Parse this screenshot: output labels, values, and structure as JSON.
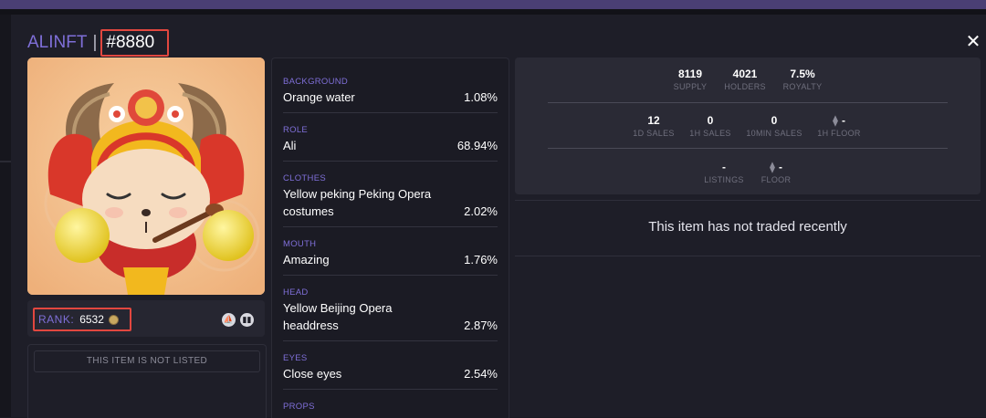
{
  "header": {
    "collection": "ALINFT",
    "separator": "|",
    "token_id": "#8880",
    "close_icon": "close-icon"
  },
  "rank": {
    "label": "RANK:",
    "value": "6532",
    "coin_icon": "coin-icon",
    "icons": [
      "opensea-icon",
      "chart-icon"
    ]
  },
  "listing": {
    "status": "THIS ITEM IS NOT LISTED"
  },
  "traits": [
    {
      "type": "BACKGROUND",
      "value": "Orange water",
      "percent": "1.08%"
    },
    {
      "type": "ROLE",
      "value": "Ali",
      "percent": "68.94%"
    },
    {
      "type": "CLOTHES",
      "value": "Yellow peking Peking Opera costumes",
      "percent": "2.02%"
    },
    {
      "type": "MOUTH",
      "value": "Amazing",
      "percent": "1.76%"
    },
    {
      "type": "HEAD",
      "value": "Yellow Beijing Opera headdress",
      "percent": "2.87%"
    },
    {
      "type": "EYES",
      "value": "Close eyes",
      "percent": "2.54%"
    },
    {
      "type": "PROPS",
      "value": "",
      "percent": ""
    }
  ],
  "stats": {
    "supply": {
      "value": "8119",
      "label": "SUPPLY"
    },
    "holders": {
      "value": "4021",
      "label": "HOLDERS"
    },
    "royalty": {
      "value": "7.5%",
      "label": "ROYALTY"
    },
    "sales_1d": {
      "value": "12",
      "label": "1D SALES"
    },
    "sales_1h": {
      "value": "0",
      "label": "1H SALES"
    },
    "sales_10min": {
      "value": "0",
      "label": "10MIN SALES"
    },
    "floor_1h": {
      "value": "-",
      "label": "1H FLOOR"
    },
    "listings": {
      "value": "-",
      "label": "LISTINGS"
    },
    "floor": {
      "value": "-",
      "label": "FLOOR"
    },
    "eth_symbol": "⧫"
  },
  "trading": {
    "message": "This item has not traded recently"
  },
  "colors": {
    "accent": "#7f6fd8",
    "highlight_box": "#e2473f",
    "background": "#1e1e28"
  }
}
